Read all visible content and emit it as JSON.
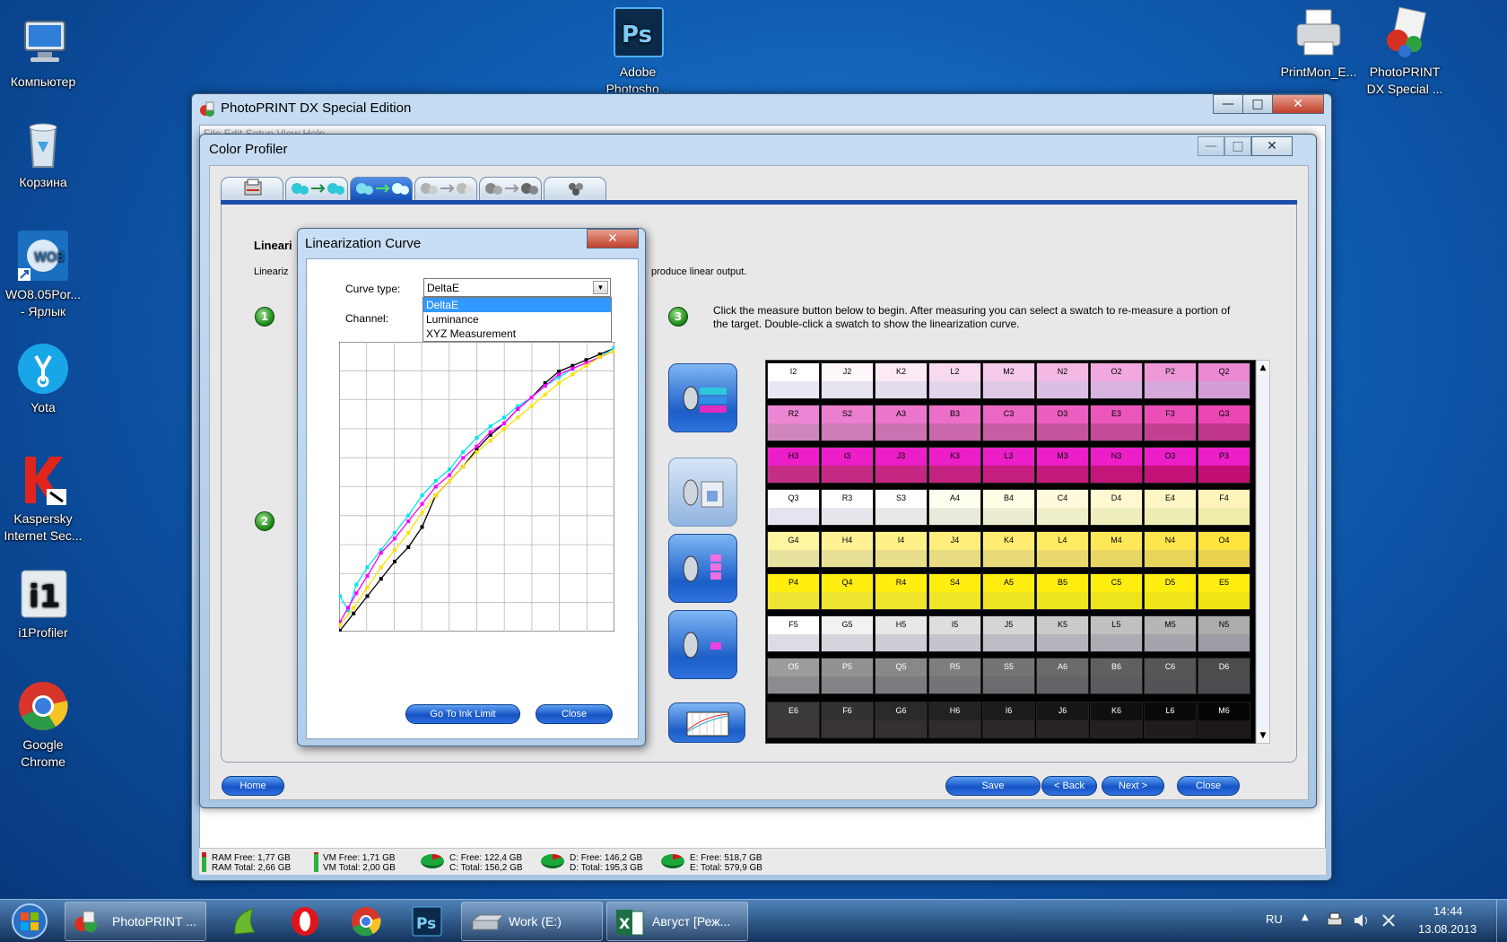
{
  "desktop": {
    "icons": [
      {
        "label": "Компьютер",
        "icon": "computer-icon"
      },
      {
        "label": "Корзина",
        "icon": "recycle-bin-icon"
      },
      {
        "label": "WO8.05Por... - Ярлык",
        "icon": "wo8-shortcut-icon"
      },
      {
        "label": "Yota",
        "icon": "yota-icon"
      },
      {
        "label": "Kaspersky Internet Sec...",
        "icon": "kaspersky-icon"
      },
      {
        "label": "i1Profiler",
        "icon": "i1profiler-icon"
      },
      {
        "label": "Google Chrome",
        "icon": "chrome-icon"
      },
      {
        "label": "Adobe Photosho...",
        "icon": "photoshop-icon"
      },
      {
        "label": "PrintMon_E...",
        "icon": "printer-icon"
      },
      {
        "label": "PhotoPRINT DX Special ...",
        "icon": "photoprint-icon"
      }
    ]
  },
  "main_window": {
    "title": "PhotoPRINT DX Special Edition",
    "menu_hint": "File  Edit  Setup  View  Help"
  },
  "color_profiler": {
    "title": "Color Profiler",
    "heading": "Lineari",
    "description_left": "Lineariz",
    "description_right": "produce linear output.",
    "steps": [
      "1",
      "2",
      "3"
    ],
    "instruction": "Click the measure button below to begin. After measuring you can select a swatch to re-measure a portion of the target. Double-click a swatch to show the linearization curve.",
    "buttons": {
      "home": "Home",
      "save": "Save",
      "back": "< Back",
      "next": "Next >",
      "close": "Close"
    }
  },
  "dialog": {
    "title": "Linearization Curve",
    "curve_type_label": "Curve type:",
    "curve_type_value": "DeltaE",
    "channel_label": "Channel:",
    "options": [
      "DeltaE",
      "Luminance",
      "XYZ Measurement"
    ],
    "selected_option": "DeltaE",
    "go_to_ink_limit": "Go To Ink Limit",
    "close": "Close"
  },
  "swatch_rows": [
    {
      "labels": [
        "I2",
        "J2",
        "K2",
        "L2",
        "M2",
        "N2",
        "O2",
        "P2",
        "Q2"
      ],
      "label_colors": [
        "#ffffff",
        "#fdf6fb",
        "#fbeaf5",
        "#f8d9ef",
        "#f6caea",
        "#f3b9e4",
        "#f0a8de",
        "#ee98d8",
        "#eb88d2"
      ],
      "fill_colors": [
        "#e8e8f4",
        "#e6e2ee",
        "#e4dcec",
        "#e2d4ea",
        "#dec8e6",
        "#dcbee4",
        "#d9b3e0",
        "#d6a8dc",
        "#d39ed8"
      ]
    },
    {
      "labels": [
        "R2",
        "S2",
        "A3",
        "B3",
        "C3",
        "D3",
        "E3",
        "F3",
        "G3"
      ],
      "label_colors": [
        "#ec86d4",
        "#ec7ed0",
        "#ec76cc",
        "#ec6ec8",
        "#ec66c4",
        "#ec5ec0",
        "#ec56bc",
        "#ec4eb8",
        "#ec46b4"
      ],
      "fill_colors": [
        "#cf86bd",
        "#cd7cb6",
        "#cb72b0",
        "#c968aa",
        "#c75ea4",
        "#c5549e",
        "#c34a98",
        "#c14092",
        "#bf368c"
      ]
    },
    {
      "labels": [
        "H3",
        "I3",
        "J3",
        "K3",
        "L3",
        "M3",
        "N3",
        "O3",
        "P3"
      ],
      "label_colors": [
        "#ec1ec8",
        "#ec1ec8",
        "#ec1ec8",
        "#ec1ec8",
        "#ec1ec8",
        "#ec1ec8",
        "#ec1ec8",
        "#ec1ec8",
        "#ec1ec8"
      ],
      "fill_colors": [
        "#c42e86",
        "#c42a84",
        "#c42682",
        "#c42280",
        "#c41e7e",
        "#c41a7c",
        "#c4167a",
        "#c41278",
        "#c40e76"
      ]
    },
    {
      "labels": [
        "Q3",
        "R3",
        "S3",
        "A4",
        "B4",
        "C4",
        "D4",
        "E4",
        "F4"
      ],
      "label_colors": [
        "#ffffff",
        "#ffffff",
        "#ffffff",
        "#fffff0",
        "#fffde6",
        "#fffadb",
        "#fff8d0",
        "#fff6c5",
        "#fff4ba"
      ],
      "fill_colors": [
        "#e4e4f0",
        "#e6e6ec",
        "#e8e8e6",
        "#eaeadc",
        "#ececd2",
        "#eeeec8",
        "#eeeebe",
        "#eeeeb4",
        "#eeeeaa"
      ]
    },
    {
      "labels": [
        "G4",
        "H4",
        "I4",
        "J4",
        "K4",
        "L4",
        "M4",
        "N4",
        "O4"
      ],
      "label_colors": [
        "#fff4a0",
        "#fff294",
        "#fff088",
        "#ffee7c",
        "#ffec70",
        "#ffea64",
        "#ffe858",
        "#ffe64c",
        "#ffe440"
      ],
      "fill_colors": [
        "#e8e2a0",
        "#e8e096",
        "#e8de8c",
        "#e8dc82",
        "#e8da78",
        "#e8d86e",
        "#e8d664",
        "#e8d45a",
        "#e8d250"
      ]
    },
    {
      "labels": [
        "P4",
        "Q4",
        "R4",
        "S4",
        "A5",
        "B5",
        "C5",
        "D5",
        "E5"
      ],
      "label_colors": [
        "#ffee10",
        "#ffee10",
        "#ffee10",
        "#ffee10",
        "#ffee10",
        "#ffee10",
        "#ffee10",
        "#ffee10",
        "#ffee10"
      ],
      "fill_colors": [
        "#eee434",
        "#eee430",
        "#eee42c",
        "#eee428",
        "#eee424",
        "#eee420",
        "#eee41c",
        "#eee418",
        "#eee414"
      ]
    },
    {
      "labels": [
        "F5",
        "G5",
        "H5",
        "I5",
        "J5",
        "K5",
        "L5",
        "M5",
        "N5"
      ],
      "label_colors": [
        "#ffffff",
        "#f2f2f2",
        "#e8e8e8",
        "#dedede",
        "#d4d4d4",
        "#cacaca",
        "#c0c0c0",
        "#b6b6b6",
        "#acacac"
      ],
      "fill_colors": [
        "#dcdce4",
        "#d4d4dc",
        "#ccccd4",
        "#c4c4cc",
        "#bcbcc4",
        "#b4b4bc",
        "#acacb4",
        "#a4a4ac",
        "#9c9ca4"
      ]
    },
    {
      "labels": [
        "O5",
        "P5",
        "Q5",
        "R5",
        "S5",
        "A6",
        "B6",
        "C6",
        "D6"
      ],
      "label_colors": [
        "#9c9c9c",
        "#929292",
        "#888888",
        "#7e7e7e",
        "#747474",
        "#6a6a6a",
        "#606060",
        "#565656",
        "#4c4c4c"
      ],
      "fill_colors": [
        "#8c8c90",
        "#848488",
        "#7c7c80",
        "#747478",
        "#6c6c70",
        "#646468",
        "#5c5c60",
        "#545458",
        "#4c4c50"
      ]
    },
    {
      "labels": [
        "E6",
        "F6",
        "G6",
        "H6",
        "I6",
        "J6",
        "K6",
        "L6",
        "M6"
      ],
      "label_colors": [
        "#3a3a3a",
        "#323232",
        "#2a2a2a",
        "#222222",
        "#1c1c1c",
        "#161616",
        "#101010",
        "#0a0a0a",
        "#050505"
      ],
      "fill_colors": [
        "#3c3838",
        "#383434",
        "#343030",
        "#302c2c",
        "#2c2828",
        "#282424",
        "#242020",
        "#201c1c",
        "#1c1818"
      ]
    }
  ],
  "status_bar": {
    "ram_free": "RAM Free: 1,77 GB",
    "ram_total": "RAM Total: 2,66 GB",
    "vm_free": "VM Free: 1,71 GB",
    "vm_total": "VM Total: 2,00 GB",
    "c_free": "C: Free: 122,4 GB",
    "c_total": "C: Total: 156,2 GB",
    "d_free": "D: Free: 146,2 GB",
    "d_total": "D: Total: 195,3 GB",
    "e_free": "E: Free: 518,7 GB",
    "e_total": "E: Total: 579,9 GB"
  },
  "taskbar": {
    "items": [
      {
        "label": "PhotoPRINT ...",
        "icon": "photoprint-icon"
      },
      {
        "label": "",
        "icon": "corel-icon"
      },
      {
        "label": "",
        "icon": "opera-icon"
      },
      {
        "label": "",
        "icon": "chrome-icon"
      },
      {
        "label": "",
        "icon": "photoshop-icon"
      },
      {
        "label": "Work (E:)",
        "icon": "drive-icon"
      },
      {
        "label": "Август  [Реж...",
        "icon": "excel-icon"
      }
    ],
    "language": "RU",
    "time": "14:44",
    "date": "13.08.2013"
  },
  "chart_data": {
    "type": "line",
    "title": "",
    "xlabel": "",
    "ylabel": "",
    "xlim": [
      0,
      100
    ],
    "ylim": [
      0,
      100
    ],
    "grid": true,
    "series": [
      {
        "color": "#000000",
        "x": [
          0,
          5,
          10,
          15,
          20,
          25,
          30,
          35,
          40,
          45,
          50,
          55,
          60,
          65,
          70,
          75,
          80,
          85,
          90,
          95,
          100
        ],
        "y": [
          0,
          6,
          12,
          18,
          24,
          29,
          36,
          47,
          52,
          57,
          63,
          68,
          72,
          77,
          81,
          86,
          90,
          92,
          94,
          96,
          98
        ]
      },
      {
        "color": "#00e5ee",
        "x": [
          0,
          3,
          6,
          10,
          15,
          20,
          25,
          30,
          35,
          40,
          45,
          50,
          55,
          60,
          65,
          70,
          75,
          80,
          85,
          90,
          95,
          100
        ],
        "y": [
          12,
          7,
          16,
          22,
          28,
          34,
          40,
          47,
          52,
          56,
          62,
          67,
          71,
          74,
          78,
          81,
          85,
          88,
          91,
          93,
          95,
          98
        ]
      },
      {
        "color": "#ff00ff",
        "x": [
          0,
          3,
          6,
          10,
          15,
          20,
          25,
          30,
          35,
          40,
          45,
          50,
          55,
          60,
          65,
          70,
          75,
          80,
          85,
          90,
          95,
          100
        ],
        "y": [
          3,
          8,
          13,
          19,
          27,
          32,
          38,
          44,
          50,
          54,
          60,
          64,
          69,
          72,
          77,
          81,
          85,
          89,
          91,
          93,
          95,
          97
        ]
      },
      {
        "color": "#ffe000",
        "x": [
          0,
          5,
          10,
          15,
          20,
          25,
          30,
          35,
          40,
          45,
          50,
          55,
          60,
          65,
          70,
          75,
          80,
          85,
          90,
          95,
          100
        ],
        "y": [
          2,
          8,
          15,
          22,
          28,
          34,
          41,
          47,
          52,
          57,
          62,
          66,
          70,
          74,
          78,
          82,
          86,
          89,
          92,
          95,
          97
        ]
      }
    ]
  }
}
